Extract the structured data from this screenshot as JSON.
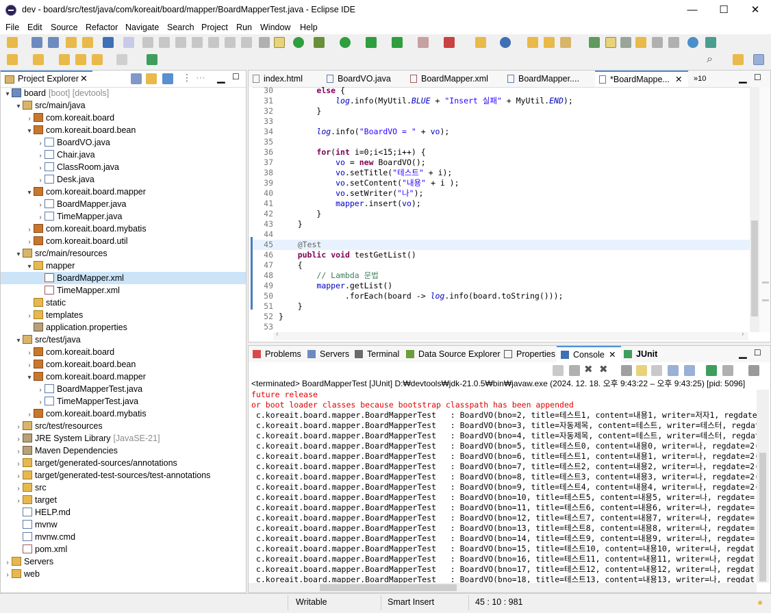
{
  "window": {
    "title": "dev - board/src/test/java/com/koreait/board/mapper/BoardMapperTest.java - Eclipse IDE",
    "minimize": "—",
    "maximize": "☐",
    "close": "✕"
  },
  "menu": [
    "File",
    "Edit",
    "Source",
    "Refactor",
    "Navigate",
    "Search",
    "Project",
    "Run",
    "Window",
    "Help"
  ],
  "explorer": {
    "tab_label": "Project Explorer",
    "rows": [
      {
        "indent": 0,
        "chev": "⌄",
        "icon": "proj",
        "label": "board",
        "suffix": "[boot] [devtools]"
      },
      {
        "indent": 1,
        "chev": "⌄",
        "icon": "srcf",
        "label": "src/main/java",
        "suffix": ""
      },
      {
        "indent": 2,
        "chev": "›",
        "icon": "pkg",
        "label": "com.koreait.board",
        "suffix": ""
      },
      {
        "indent": 2,
        "chev": "⌄",
        "icon": "pkg",
        "label": "com.koreait.board.bean",
        "suffix": ""
      },
      {
        "indent": 3,
        "chev": "›",
        "icon": "jfile",
        "label": "BoardVO.java",
        "suffix": ""
      },
      {
        "indent": 3,
        "chev": "›",
        "icon": "jfile",
        "label": "Chair.java",
        "suffix": ""
      },
      {
        "indent": 3,
        "chev": "›",
        "icon": "jfile",
        "label": "ClassRoom.java",
        "suffix": ""
      },
      {
        "indent": 3,
        "chev": "›",
        "icon": "jfile",
        "label": "Desk.java",
        "suffix": ""
      },
      {
        "indent": 2,
        "chev": "⌄",
        "icon": "pkg",
        "label": "com.koreait.board.mapper",
        "suffix": ""
      },
      {
        "indent": 3,
        "chev": "›",
        "icon": "jfile",
        "label": "BoardMapper.java",
        "suffix": ""
      },
      {
        "indent": 3,
        "chev": "›",
        "icon": "jfile",
        "label": "TimeMapper.java",
        "suffix": ""
      },
      {
        "indent": 2,
        "chev": "›",
        "icon": "pkg",
        "label": "com.koreait.board.mybatis",
        "suffix": ""
      },
      {
        "indent": 2,
        "chev": "›",
        "icon": "pkg",
        "label": "com.koreait.board.util",
        "suffix": ""
      },
      {
        "indent": 1,
        "chev": "⌄",
        "icon": "srcf",
        "label": "src/main/resources",
        "suffix": ""
      },
      {
        "indent": 2,
        "chev": "⌄",
        "icon": "folder",
        "label": "mapper",
        "suffix": ""
      },
      {
        "indent": 3,
        "chev": "",
        "icon": "xfile",
        "label": "BoardMapper.xml",
        "suffix": "",
        "selected": true
      },
      {
        "indent": 3,
        "chev": "",
        "icon": "xfile",
        "label": "TimeMapper.xml",
        "suffix": ""
      },
      {
        "indent": 2,
        "chev": "",
        "icon": "folder",
        "label": "static",
        "suffix": ""
      },
      {
        "indent": 2,
        "chev": "›",
        "icon": "folder",
        "label": "templates",
        "suffix": ""
      },
      {
        "indent": 2,
        "chev": "",
        "icon": "lib",
        "label": "application.properties",
        "suffix": ""
      },
      {
        "indent": 1,
        "chev": "⌄",
        "icon": "srcf",
        "label": "src/test/java",
        "suffix": ""
      },
      {
        "indent": 2,
        "chev": "›",
        "icon": "pkg",
        "label": "com.koreait.board",
        "suffix": ""
      },
      {
        "indent": 2,
        "chev": "›",
        "icon": "pkg",
        "label": "com.koreait.board.bean",
        "suffix": ""
      },
      {
        "indent": 2,
        "chev": "⌄",
        "icon": "pkg",
        "label": "com.koreait.board.mapper",
        "suffix": ""
      },
      {
        "indent": 3,
        "chev": "›",
        "icon": "jfile",
        "label": "BoardMapperTest.java",
        "suffix": ""
      },
      {
        "indent": 3,
        "chev": "›",
        "icon": "jfile",
        "label": "TimeMapperTest.java",
        "suffix": ""
      },
      {
        "indent": 2,
        "chev": "›",
        "icon": "pkg",
        "label": "com.koreait.board.mybatis",
        "suffix": ""
      },
      {
        "indent": 1,
        "chev": "›",
        "icon": "srcf",
        "label": "src/test/resources",
        "suffix": ""
      },
      {
        "indent": 1,
        "chev": "›",
        "icon": "lib",
        "label": "JRE System Library",
        "suffix": "[JavaSE-21]"
      },
      {
        "indent": 1,
        "chev": "›",
        "icon": "lib",
        "label": "Maven Dependencies",
        "suffix": ""
      },
      {
        "indent": 1,
        "chev": "›",
        "icon": "folder",
        "label": "target/generated-sources/annotations",
        "suffix": ""
      },
      {
        "indent": 1,
        "chev": "›",
        "icon": "folder",
        "label": "target/generated-test-sources/test-annotations",
        "suffix": ""
      },
      {
        "indent": 1,
        "chev": "›",
        "icon": "folder",
        "label": "src",
        "suffix": ""
      },
      {
        "indent": 1,
        "chev": "›",
        "icon": "folder",
        "label": "target",
        "suffix": ""
      },
      {
        "indent": 1,
        "chev": "",
        "icon": "jfile",
        "label": "HELP.md",
        "suffix": ""
      },
      {
        "indent": 1,
        "chev": "",
        "icon": "jfile",
        "label": "mvnw",
        "suffix": ""
      },
      {
        "indent": 1,
        "chev": "",
        "icon": "jfile",
        "label": "mvnw.cmd",
        "suffix": ""
      },
      {
        "indent": 1,
        "chev": "",
        "icon": "xfile",
        "label": "pom.xml",
        "suffix": ""
      },
      {
        "indent": 0,
        "chev": "›",
        "icon": "folder",
        "label": "Servers",
        "suffix": ""
      },
      {
        "indent": 0,
        "chev": "›",
        "icon": "folder",
        "label": "web",
        "suffix": ""
      }
    ]
  },
  "editor": {
    "tabs": [
      "index.html",
      "BoardVO.java",
      "BoardMapper.xml",
      "BoardMapper....",
      "*BoardMappe..."
    ],
    "overflow": "»10",
    "lines": [
      {
        "n": "30",
        "html": "        <span class='kw'>else</span> {"
      },
      {
        "n": "31",
        "html": "            <span class='ital'>log</span>.info(MyUtil.<span class='ital'>BLUE</span> + <span class='str'>\"Insert 실패\"</span> + MyUtil.<span class='ital'>END</span>);"
      },
      {
        "n": "32",
        "html": "        }"
      },
      {
        "n": "33",
        "html": ""
      },
      {
        "n": "34",
        "html": "        <span class='ital'>log</span>.info(<span class='str'>\"BoardVO = \"</span> + <span class='fld'>vo</span>);"
      },
      {
        "n": "35",
        "html": ""
      },
      {
        "n": "36",
        "html": "        <span class='kw'>for</span>(<span class='kw'>int</span> i=0;i&lt;15;i++) {"
      },
      {
        "n": "37",
        "html": "            <span class='fld'>vo</span> = <span class='kw'>new</span> BoardVO();"
      },
      {
        "n": "38",
        "html": "            <span class='fld'>vo</span>.setTitle(<span class='str'>\"테스트\"</span> + i);"
      },
      {
        "n": "39",
        "html": "            <span class='fld'>vo</span>.setContent(<span class='str'>\"내용\"</span> + i );"
      },
      {
        "n": "40",
        "html": "            <span class='fld'>vo</span>.setWriter(<span class='str'>\"나\"</span>);"
      },
      {
        "n": "41",
        "html": "            <span class='fld'>mapper</span>.insert(<span class='fld'>vo</span>);"
      },
      {
        "n": "42",
        "html": "        }"
      },
      {
        "n": "43",
        "html": "    }"
      },
      {
        "n": "44",
        "html": ""
      },
      {
        "n": "45",
        "html": "    <span class='ann'>@Test</span>",
        "current": true
      },
      {
        "n": "46",
        "html": "    <span class='kw'>public</span> <span class='kw'>void</span> testGetList()"
      },
      {
        "n": "47",
        "html": "    {"
      },
      {
        "n": "48",
        "html": "        <span class='cmt'>// Lambda 문법</span>"
      },
      {
        "n": "49",
        "html": "        <span class='fld'>mapper</span>.getList()"
      },
      {
        "n": "50",
        "html": "              .forEach(board -&gt; <span class='ital'>log</span>.info(board.toString()));"
      },
      {
        "n": "51",
        "html": "    }"
      },
      {
        "n": "52",
        "html": "}"
      },
      {
        "n": "53",
        "html": ""
      }
    ]
  },
  "bottom": {
    "tabs": [
      "Problems",
      "Servers",
      "Terminal",
      "Data Source Explorer",
      "Properties",
      "Console",
      "JUnit"
    ],
    "header": "<terminated> BoardMapperTest [JUnit] D:₩devtools₩jdk-21.0.5₩bin₩javaw.exe  (2024. 12. 18. 오후 9:43:22 – 오후 9:43:25) [pid: 5096]",
    "lines": [
      {
        "cls": "red",
        "text": "future release"
      },
      {
        "cls": "red",
        "text": "or boot loader classes because bootstrap classpath has been appended"
      },
      {
        "cls": "",
        "text": " c.koreait.board.mapper.BoardMapperTest   : BoardVO(bno=2, title=테스트1, content=내용1, writer=저자1, regdate"
      },
      {
        "cls": "",
        "text": " c.koreait.board.mapper.BoardMapperTest   : BoardVO(bno=3, title=자동제목, content=테스트, writer=테스터, regdat"
      },
      {
        "cls": "",
        "text": " c.koreait.board.mapper.BoardMapperTest   : BoardVO(bno=4, title=자동제목, content=테스트, writer=테스터, regdat"
      },
      {
        "cls": "",
        "text": " c.koreait.board.mapper.BoardMapperTest   : BoardVO(bno=5, title=테스트0, content=내용0, writer=나, regdate=2("
      },
      {
        "cls": "",
        "text": " c.koreait.board.mapper.BoardMapperTest   : BoardVO(bno=6, title=테스트1, content=내용1, writer=나, regdate=2("
      },
      {
        "cls": "",
        "text": " c.koreait.board.mapper.BoardMapperTest   : BoardVO(bno=7, title=테스트2, content=내용2, writer=나, regdate=2("
      },
      {
        "cls": "",
        "text": " c.koreait.board.mapper.BoardMapperTest   : BoardVO(bno=8, title=테스트3, content=내용3, writer=나, regdate=2("
      },
      {
        "cls": "",
        "text": " c.koreait.board.mapper.BoardMapperTest   : BoardVO(bno=9, title=테스트4, content=내용4, writer=나, regdate=2("
      },
      {
        "cls": "",
        "text": " c.koreait.board.mapper.BoardMapperTest   : BoardVO(bno=10, title=테스트5, content=내용5, writer=나, regdate="
      },
      {
        "cls": "",
        "text": " c.koreait.board.mapper.BoardMapperTest   : BoardVO(bno=11, title=테스트6, content=내용6, writer=나, regdate="
      },
      {
        "cls": "",
        "text": " c.koreait.board.mapper.BoardMapperTest   : BoardVO(bno=12, title=테스트7, content=내용7, writer=나, regdate="
      },
      {
        "cls": "",
        "text": " c.koreait.board.mapper.BoardMapperTest   : BoardVO(bno=13, title=테스트8, content=내용8, writer=나, regdate="
      },
      {
        "cls": "",
        "text": " c.koreait.board.mapper.BoardMapperTest   : BoardVO(bno=14, title=테스트9, content=내용9, writer=나, regdate="
      },
      {
        "cls": "",
        "text": " c.koreait.board.mapper.BoardMapperTest   : BoardVO(bno=15, title=테스트10, content=내용10, writer=나, regdat"
      },
      {
        "cls": "",
        "text": " c.koreait.board.mapper.BoardMapperTest   : BoardVO(bno=16, title=테스트11, content=내용11, writer=나, regdat"
      },
      {
        "cls": "",
        "text": " c.koreait.board.mapper.BoardMapperTest   : BoardVO(bno=17, title=테스트12, content=내용12, writer=나, regdat"
      },
      {
        "cls": "",
        "text": " c.koreait.board.mapper.BoardMapperTest   : BoardVO(bno=18, title=테스트13, content=내용13, writer=나, regdat"
      }
    ]
  },
  "status": {
    "writable": "Writable",
    "insert_mode": "Smart Insert",
    "position": "45 : 10 : 981"
  }
}
